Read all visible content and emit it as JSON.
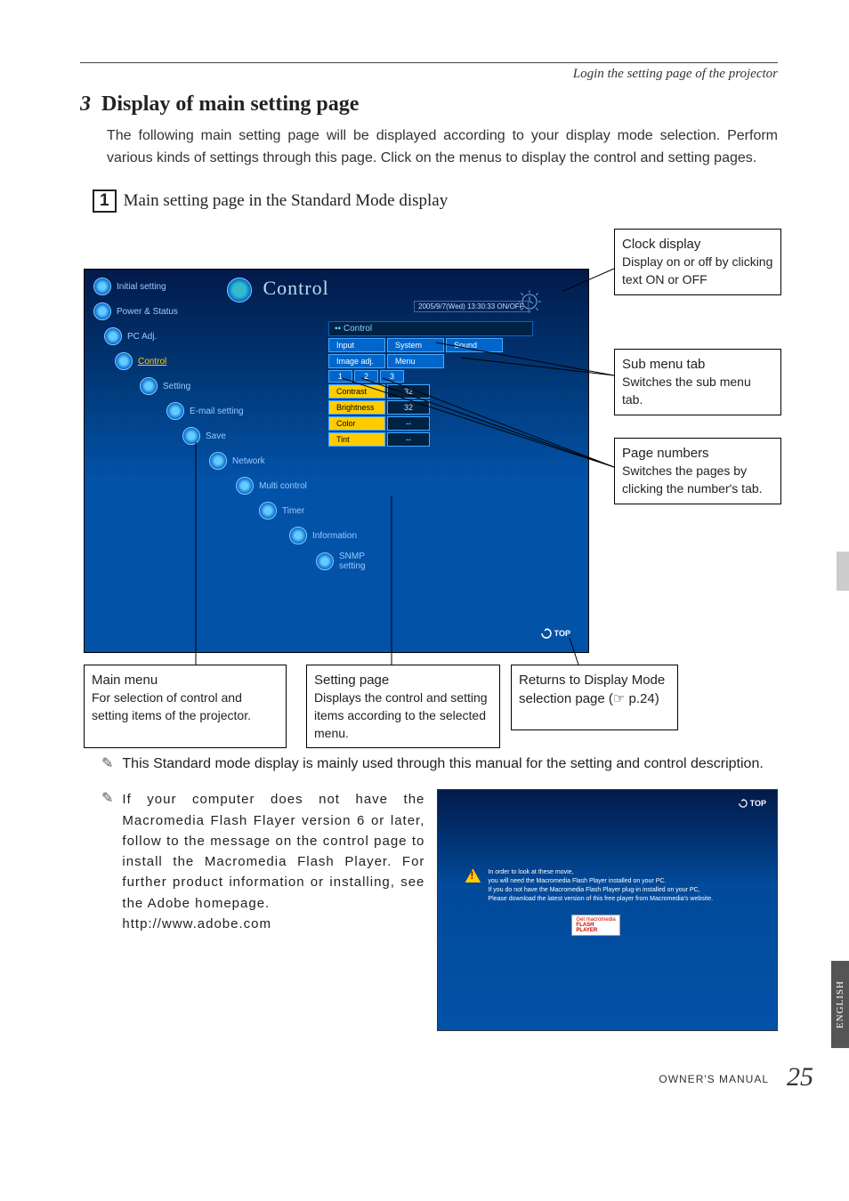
{
  "header": "Login the setting page of the projector",
  "section": {
    "num": "3",
    "title": "Display of main setting page"
  },
  "intro": "The following main setting page will be displayed according to your display mode selection. Perform various kinds of settings through this page. Click on the menus to display the control and setting pages.",
  "sub": {
    "num": "1",
    "title": "Main setting page in the Standard Mode display"
  },
  "screenshot": {
    "title": "Control",
    "datebar": "2005/9/7(Wed)  13:30:33  ON/OFF",
    "menu": [
      "Initial setting",
      "Power & Status",
      "PC Adj.",
      "Control",
      "Setting",
      "E-mail setting",
      "Save",
      "Network",
      "Multi control",
      "Timer",
      "Information",
      "SNMP setting"
    ],
    "selected_index": 3,
    "panel_title": "Control",
    "tabs1": [
      "Input",
      "System",
      "Sound"
    ],
    "tabs2": [
      "Image adj.",
      "Menu"
    ],
    "page_tabs": [
      "1",
      "2",
      "3"
    ],
    "rows": [
      {
        "k": "Contrast",
        "v": "32"
      },
      {
        "k": "Brightness",
        "v": "32"
      },
      {
        "k": "Color",
        "v": "--"
      },
      {
        "k": "Tint",
        "v": "--"
      }
    ],
    "top_label": "TOP"
  },
  "callouts": {
    "clock": {
      "t": "Clock display",
      "b": "Display on or off by clicking text ON or OFF"
    },
    "submenu": {
      "t": "Sub menu tab",
      "b": "Switches the sub menu tab."
    },
    "pagenum": {
      "t": "Page numbers",
      "b": "Switches the pages by clicking the number's tab."
    },
    "mainmenu": {
      "t": "Main menu",
      "b": "For selection of  control and setting items of the projector."
    },
    "setting": {
      "t": "Setting page",
      "b": "Displays the control and setting items according to the selected menu."
    },
    "returns": {
      "t": "Returns to Display Mode selection page (☞ p.24)"
    }
  },
  "note1": "This Standard mode display is mainly used through this manual for the setting and control description.",
  "note2": {
    "text": "If your computer does not have the Macromedia Flash Flayer version 6 or later, follow to the message on the control page to install the Macromedia Flash Player. For further product information or installing, see the Adobe homepage.",
    "url": "http://www.adobe.com"
  },
  "flash": {
    "top": "TOP",
    "warn1": "In order to look at these movie,",
    "warn2": "you will need the Macromedia Flash Player installed on your PC.",
    "warn3": "If you do not have the Macromedia Flash Player plug-in installed on your PC,",
    "warn4": "Please download the latest version of this free player from Macromedia's website.",
    "btn1": "Get macromedia",
    "btn2": "FLASH",
    "btn3": "PLAYER"
  },
  "lang": "ENGLISH",
  "footer": "OWNER'S MANUAL",
  "page": "25"
}
